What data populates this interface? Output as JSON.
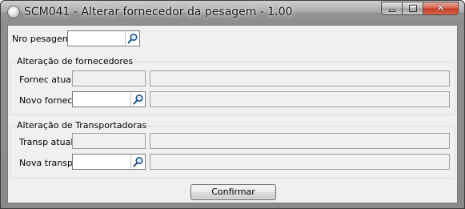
{
  "window": {
    "title": "SCM041 - Alterar fornecedor da pesagem - 1.00",
    "close_symbol": "✕"
  },
  "form": {
    "nro_pesagem_label": "Nro pesagem:",
    "nro_pesagem_value": "",
    "fornecedores_group_title": "Alteração de fornecedores",
    "fornec_atual_label": "Fornec atual:",
    "fornec_atual_code": "",
    "fornec_atual_name": "",
    "novo_fornec_label": "Novo fornec:",
    "novo_fornec_code": "",
    "novo_fornec_name": "",
    "transportadoras_group_title": "Alteração de Transportadoras",
    "transp_atual_label": "Transp atual:",
    "transp_atual_code": "",
    "transp_atual_name": "",
    "nova_transp_label": "Nova transp:",
    "nova_transp_code": "",
    "nova_transp_name": "",
    "confirm_label": "Confirmar"
  },
  "icons": {
    "lookup": "magnifier-icon",
    "app": "app-icon"
  }
}
